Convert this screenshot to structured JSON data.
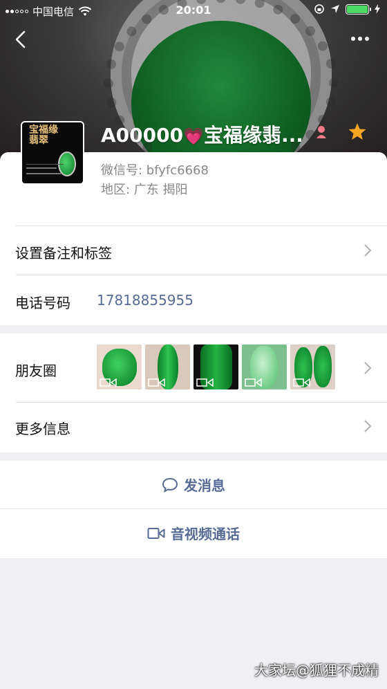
{
  "status_bar": {
    "carrier": "中国电信",
    "time": "20:01"
  },
  "profile": {
    "name_prefix": "A00000",
    "name_suffix": "宝福缘翡...",
    "heart_glyph": "💗",
    "wechat_id": "微信号:  bfyfc6668",
    "region": "地区:  广东 揭阳",
    "avatar_text": "宝福缘翡翠"
  },
  "rows": {
    "remark_label": "设置备注和标签",
    "phone_label": "电话号码",
    "phone_value": "17818855955",
    "moments_label": "朋友圈",
    "more_label": "更多信息"
  },
  "actions": {
    "message": "发消息",
    "call": "音视频通话"
  },
  "watermark": "大家坛@狐狸不成精",
  "colors": {
    "link": "#576b95",
    "star": "#f5a623",
    "jade": "#17a33a",
    "battery": "#4cd964"
  }
}
